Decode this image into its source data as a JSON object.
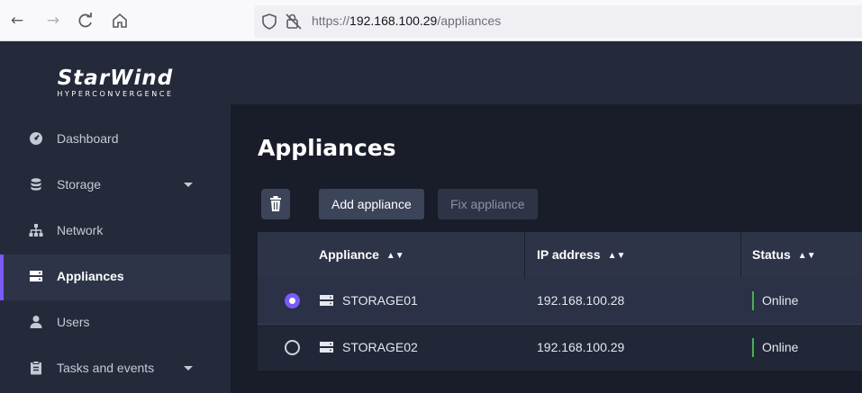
{
  "browser": {
    "url_scheme": "https://",
    "url_host": "192.168.100.29",
    "url_path": "/appliances"
  },
  "sidebar": {
    "logo_main": "StarWind",
    "logo_sub": "HYPERCONVERGENCE",
    "items": [
      {
        "label": "Dashboard",
        "icon": "dashboard-icon"
      },
      {
        "label": "Storage",
        "icon": "database-icon",
        "has_submenu": true
      },
      {
        "label": "Network",
        "icon": "network-icon"
      },
      {
        "label": "Appliances",
        "icon": "server-icon",
        "active": true
      },
      {
        "label": "Users",
        "icon": "user-icon"
      },
      {
        "label": "Tasks and events",
        "icon": "clipboard-icon",
        "has_submenu": true
      }
    ]
  },
  "main": {
    "title": "Appliances",
    "toolbar": {
      "add_label": "Add appliance",
      "fix_label": "Fix appliance"
    },
    "table": {
      "columns": [
        "Appliance",
        "IP address",
        "Status"
      ],
      "rows": [
        {
          "name": "STORAGE01",
          "ip": "192.168.100.28",
          "status": "Online",
          "selected": true
        },
        {
          "name": "STORAGE02",
          "ip": "192.168.100.29",
          "status": "Online",
          "selected": false
        }
      ]
    }
  },
  "colors": {
    "accent": "#7a5af8",
    "status_online": "#4caf50",
    "sidebar_bg": "#252a3b",
    "main_bg": "#191d2a"
  }
}
